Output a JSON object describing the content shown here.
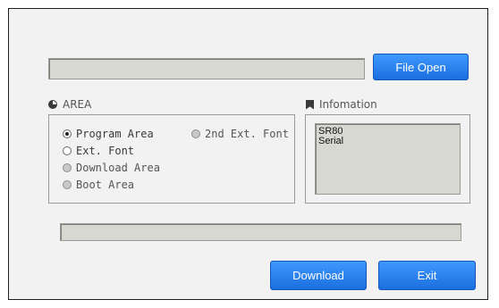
{
  "file": {
    "path_value": "",
    "open_label": "File Open"
  },
  "area": {
    "title": "AREA",
    "options": [
      {
        "label": "Program Area",
        "selected": true,
        "enabled": true
      },
      {
        "label": "Ext. Font",
        "selected": false,
        "enabled": true
      },
      {
        "label": "Download Area",
        "selected": false,
        "enabled": false
      },
      {
        "label": "Boot Area",
        "selected": false,
        "enabled": false
      },
      {
        "label": "2nd Ext. Font",
        "selected": false,
        "enabled": false
      }
    ]
  },
  "info": {
    "title": "Infomation",
    "lines": [
      "SR80",
      "Serial"
    ]
  },
  "progress": {
    "value": 0
  },
  "actions": {
    "download_label": "Download",
    "exit_label": "Exit"
  },
  "colors": {
    "accent": "#2a80f0",
    "window_bg": "#f2f2f2",
    "field_bg": "#d8d8d2"
  }
}
